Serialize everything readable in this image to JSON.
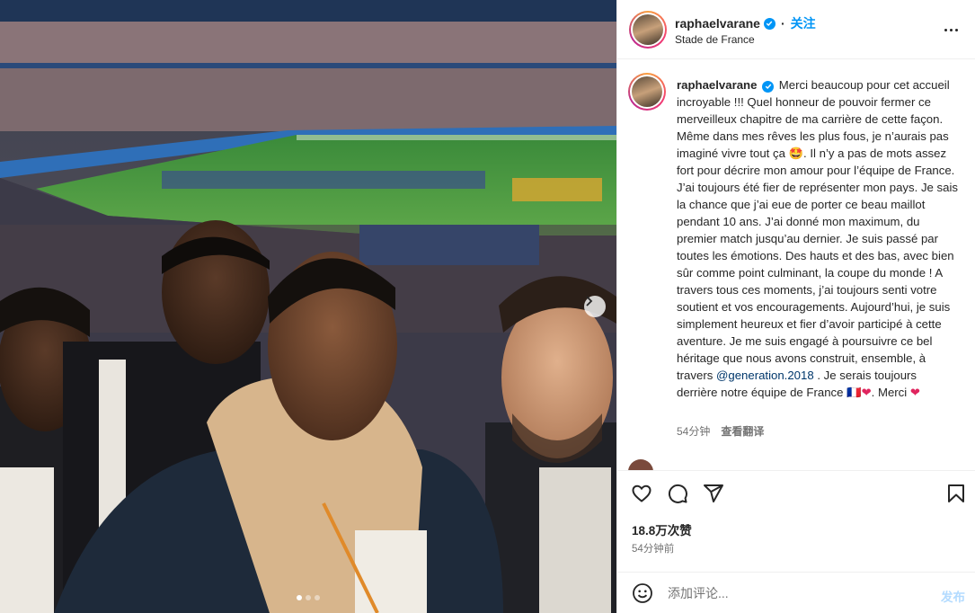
{
  "post": {
    "username": "raphaelvarane",
    "follow_label": "关注",
    "location": "Stade de France",
    "caption_user": "raphaelvarane",
    "caption_text_1": "Merci beaucoup pour cet accueil incroyable !!! Quel honneur de pouvoir fermer ce merveilleux chapitre de ma carrière de cette façon. Même dans mes rêves les plus fous, je n’aurais pas imaginé vivre tout ça 🤩. Il n’y a pas de mots assez fort pour décrire mon amour pour l’équipe de France. J’ai toujours été fier de représenter mon pays. Je sais la chance que j’ai eue de porter ce beau maillot pendant 10 ans. J’ai donné mon maximum, du premier match jusqu’au dernier. Je suis passé par toutes les émotions. Des hauts et des bas, avec bien sûr comme point culminant, la coupe du monde ! A travers tous ces moments, j’ai toujours senti votre soutient et vos encouragements. Aujourd’hui, je suis simplement heureux et fier d’avoir participé à cette aventure. Je me suis engagé à poursuivre ce bel héritage que nous avons construit, ensemble, à travers ",
    "caption_mention": "@generation.2018",
    "caption_text_2": " . Je serais toujours derrière notre équipe de France 🇫🇷",
    "caption_heart": "❤",
    "caption_text_3": ". Merci ",
    "caption_heart_2": "❤",
    "caption_age": "54分钟",
    "translate_label": "查看翻译",
    "likes": "18.8万次赞",
    "posted_time": "54分钟前"
  },
  "comment": {
    "placeholder": "添加评论...",
    "post_label": "发布"
  },
  "icons": {
    "like": "heart-icon",
    "comment": "comment-icon",
    "share": "share-icon",
    "save": "bookmark-icon",
    "emoji": "emoji-icon",
    "more": "more-options-icon",
    "next": "chevron-right-icon",
    "verified": "verified-badge-icon"
  },
  "carousel": {
    "count": 3,
    "active": 1
  },
  "colors": {
    "accent": "#0095f6",
    "post_disabled": "#b3dbff",
    "heart": "#e0245e",
    "mention": "#00376b"
  }
}
